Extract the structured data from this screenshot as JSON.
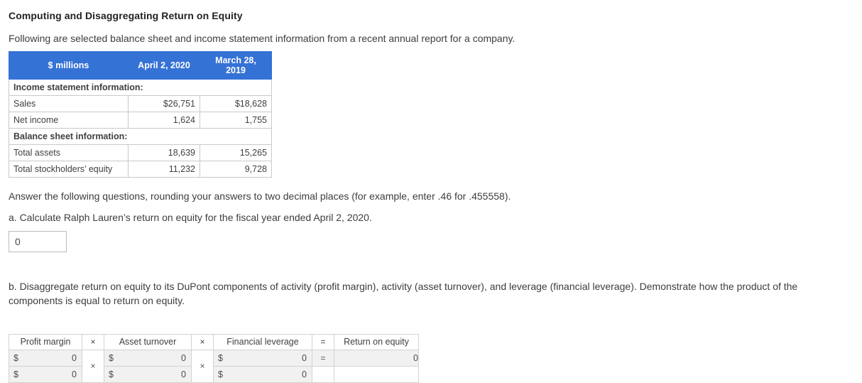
{
  "title": "Computing and Disaggregating Return on Equity",
  "intro": "Following are selected balance sheet and income statement information from a recent annual report for a company.",
  "fin_table": {
    "headers": [
      "$ millions",
      "April 2, 2020",
      "March 28, 2019"
    ],
    "rows": [
      {
        "type": "section",
        "label": "Income statement information:"
      },
      {
        "type": "data",
        "label": "Sales",
        "v1": "$26,751",
        "v2": "$18,628"
      },
      {
        "type": "data",
        "label": "Net income",
        "v1": "1,624",
        "v2": "1,755"
      },
      {
        "type": "section",
        "label": "Balance sheet information:"
      },
      {
        "type": "data",
        "label": "Total assets",
        "v1": "18,639",
        "v2": "15,265"
      },
      {
        "type": "data",
        "label": "Total stockholders’ equity",
        "v1": "11,232",
        "v2": "9,728"
      }
    ]
  },
  "instructions": "Answer the following questions, rounding your answers to two decimal places (for example, enter .46 for .455558).",
  "question_a": {
    "text": "a. Calculate Ralph Lauren’s return on equity for the fiscal year ended April 2, 2020.",
    "answer_value": "0"
  },
  "question_b": {
    "text": "b. Disaggregate return on equity to its DuPont components of activity (profit margin), activity (asset turnover), and leverage (financial leverage). Demonstrate how the product of the components is equal to return on equity."
  },
  "dupont_table": {
    "headers": {
      "profit_margin": "Profit margin",
      "op1": "×",
      "asset_turnover": "Asset turnover",
      "op2": "×",
      "financial_leverage": "Financial leverage",
      "op3": "=",
      "return_on_equity": "Return on equity"
    },
    "numerator": {
      "pm_currency": "$",
      "pm_value": "0",
      "at_currency": "$",
      "at_value": "0",
      "fl_currency": "$",
      "fl_value": "0",
      "equals": "=",
      "roe_value": "0"
    },
    "denominator": {
      "pm_currency": "$",
      "pm_value": "0",
      "op1": "×",
      "at_currency": "$",
      "at_value": "0",
      "op2": "×",
      "fl_currency": "$",
      "fl_value": "0"
    }
  },
  "colors": {
    "header_blue": "#3572d6",
    "cell_gray": "#f1f1f1",
    "border_gray": "#c9c9c9"
  }
}
